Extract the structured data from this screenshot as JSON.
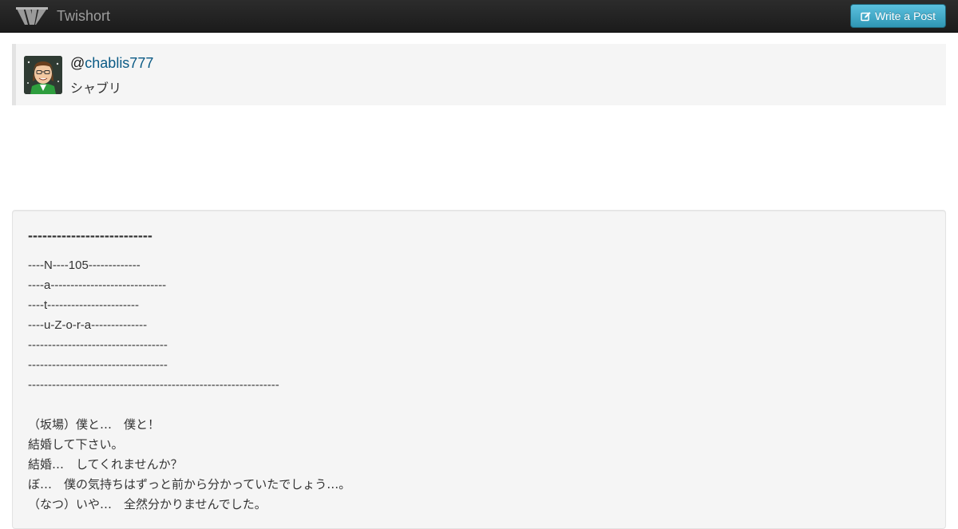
{
  "navbar": {
    "brand_name": "Twishort",
    "write_button_label": "Write a Post",
    "colors": {
      "bar": "#1b1b1b",
      "button": "#2f96b4"
    }
  },
  "user": {
    "at": "@",
    "handle": "chablis777",
    "display_name": "シャブリ",
    "link_color": "#0a5a85"
  },
  "post": {
    "title": "--------------------------",
    "lines": [
      "----N----105-------------",
      "----a-----------------------------",
      "----t-----------------------",
      "----u-Z-o-r-a--------------",
      "-----------------------------------",
      "-----------------------------------",
      "---------------------------------------------------------------",
      "",
      "（坂場）僕と…　僕と！",
      "結婚して下さい。",
      "結婚…　してくれませんか？",
      "ぼ…　僕の気持ちはずっと前から分かっていたでしょう…。",
      "（なつ）いや…　全然分かりませんでした。"
    ]
  }
}
